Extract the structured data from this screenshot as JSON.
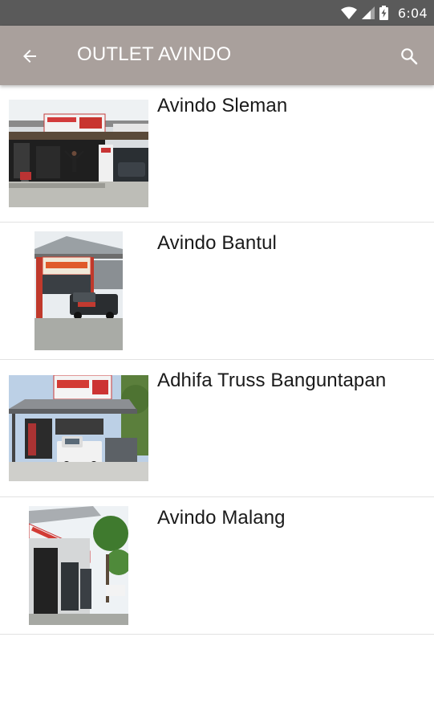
{
  "status_bar": {
    "time": "6:04",
    "icons": [
      "wifi-icon",
      "cellular-signal-icon",
      "battery-charging-icon"
    ]
  },
  "app_bar": {
    "title": "OUTLET AVINDO",
    "back_icon": "arrow-left-icon",
    "search_icon": "search-icon",
    "background": "#a9a09c"
  },
  "outlets": [
    {
      "name": "Avindo Sleman"
    },
    {
      "name": "Avindo Bantul"
    },
    {
      "name": "Adhifa Truss Banguntapan"
    },
    {
      "name": "Avindo Malang"
    }
  ]
}
